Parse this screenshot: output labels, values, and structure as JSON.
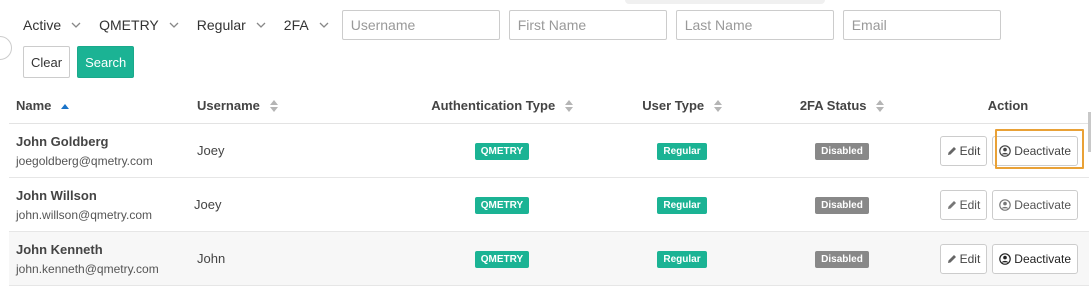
{
  "filters": {
    "dropdowns": [
      {
        "label": "Active"
      },
      {
        "label": "QMETRY"
      },
      {
        "label": "Regular"
      },
      {
        "label": "2FA"
      }
    ],
    "inputs": [
      {
        "placeholder": "Username",
        "value": ""
      },
      {
        "placeholder": "First Name",
        "value": ""
      },
      {
        "placeholder": "Last Name",
        "value": ""
      },
      {
        "placeholder": "Email",
        "value": ""
      }
    ],
    "clear_label": "Clear",
    "search_label": "Search"
  },
  "table": {
    "columns": [
      {
        "label": "Name",
        "sort": "asc"
      },
      {
        "label": "Username",
        "sort": "none"
      },
      {
        "label": "Authentication Type",
        "sort": "none"
      },
      {
        "label": "User Type",
        "sort": "none"
      },
      {
        "label": "2FA Status",
        "sort": "none"
      },
      {
        "label": "Action",
        "sort": null
      }
    ],
    "rows": [
      {
        "name": "John Goldberg",
        "email": "joegoldberg@qmetry.com",
        "username": "Joey",
        "auth": "QMETRY",
        "user_type": "Regular",
        "twofa": "Disabled",
        "edit": "Edit",
        "deactivate": "Deactivate"
      },
      {
        "name": "John Willson",
        "email": "john.willson@qmetry.com",
        "username": "Joey",
        "auth": "QMETRY",
        "user_type": "Regular",
        "twofa": "Disabled",
        "edit": "Edit",
        "deactivate": "Deactivate"
      },
      {
        "name": "John Kenneth",
        "email": "john.kenneth@qmetry.com",
        "username": "John",
        "auth": "QMETRY",
        "user_type": "Regular",
        "twofa": "Disabled",
        "edit": "Edit",
        "deactivate": "Deactivate"
      }
    ]
  },
  "colors": {
    "accent": "#1bb394",
    "badge_gray": "#888888",
    "highlight": "#e9a136"
  },
  "icons": {
    "dropdown": "chevron-down-icon",
    "sort_asc": "sort-asc-icon",
    "sort_both": "sort-icon",
    "edit": "pencil-icon",
    "deactivate": "user-circle-icon"
  }
}
